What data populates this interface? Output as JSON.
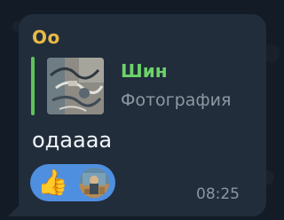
{
  "message": {
    "sender_name": "Оо",
    "reply": {
      "author": "Шин",
      "type_label": "Фотография",
      "thumbnail_icon": "photo-thumbnail-icon"
    },
    "text": "одаааа",
    "time": "08:25",
    "reaction": {
      "emoji": "👍",
      "avatar_icon": "user-avatar-icon"
    }
  },
  "colors": {
    "background": "#121b26",
    "bubble": "#212d3b",
    "sender": "#e8b946",
    "reply_accent": "#62c25b",
    "reaction_pill": "#4f8fe0"
  }
}
